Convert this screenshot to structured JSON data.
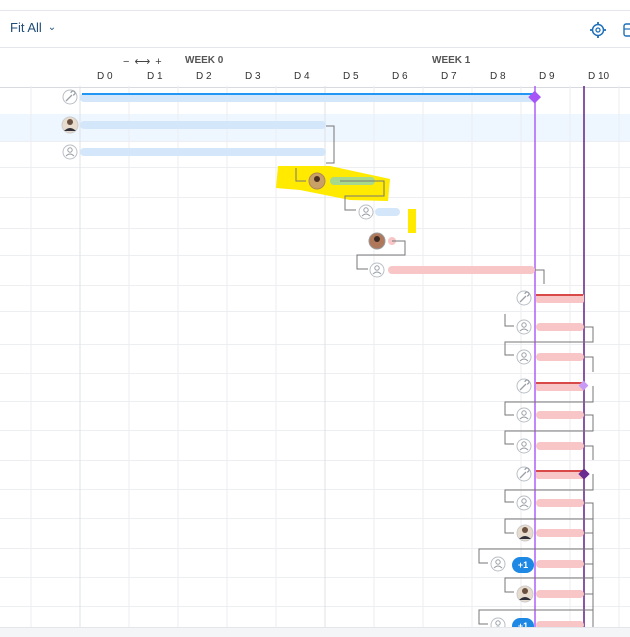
{
  "toolbar": {
    "fit_label": "Fit All",
    "zoom_controls": "− ⟷ +"
  },
  "header": {
    "weeks": [
      "WEEK 0",
      "WEEK 1"
    ],
    "days": [
      "D 0",
      "D 1",
      "D 2",
      "D 3",
      "D 4",
      "D 5",
      "D 6",
      "D 7",
      "D 8",
      "D 9",
      "D 10"
    ]
  },
  "avatar_badges": [
    "+1",
    "+1"
  ],
  "icons": [
    "gear-icon",
    "panel-icon",
    "wrench-icon",
    "user-icon",
    "chevron-down-icon"
  ],
  "colors": {
    "bar_blue": "#d4e7fa",
    "bar_blue_strong": "#2196f3",
    "bar_pink": "#f8c6c6",
    "bar_red": "#d84a4a",
    "milestone_purple": "#a855f7",
    "highlight": "#ffea00",
    "today_line": "#6b2d8f",
    "badge_blue": "#1e88e5"
  }
}
